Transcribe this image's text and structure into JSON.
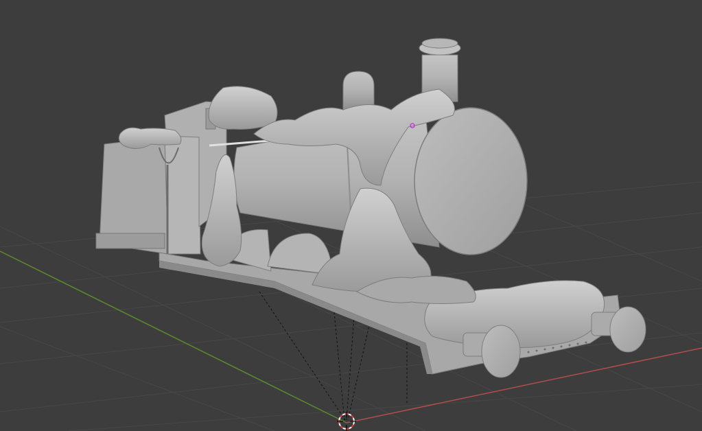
{
  "viewport": {
    "background": "#3d3d3d",
    "grid_color": "#474747",
    "x_axis_color": "#b44d4d",
    "y_axis_color": "#5c8a2a",
    "model_color": "#b5b5b5",
    "model_shade_color": "#8f8f8f",
    "selected_vertex_color": "#c43cd6",
    "cursor_color": "#ffffff",
    "cursor_accent_color": "#d14646"
  },
  "icons": {
    "cursor": "3d-cursor-icon",
    "vertex": "selected-vertex-icon"
  }
}
